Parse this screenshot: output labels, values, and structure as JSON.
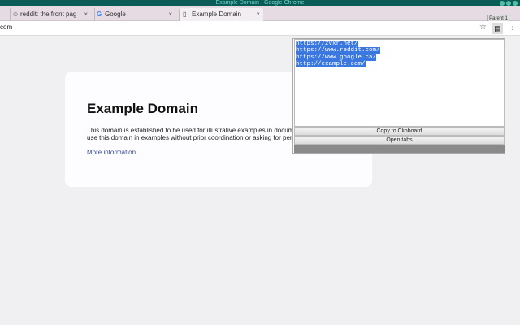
{
  "window": {
    "title": "Example Domain - Google Chrome"
  },
  "tabs": [
    {
      "label": "reddit: the front pag",
      "icon": "reddit-icon"
    },
    {
      "label": "Google",
      "icon": "google-icon"
    },
    {
      "label": "Example Domain",
      "icon": "page-icon",
      "active": true
    }
  ],
  "profile_button": "Parent 1",
  "address_bar": {
    "value": "com"
  },
  "page": {
    "heading": "Example Domain",
    "paragraph_line1": "This domain is established to be used for illustrative examples in documents. You may",
    "paragraph_line2": "use this domain in examples without prior coordination or asking for permission.",
    "link": "More information..."
  },
  "popup": {
    "urls": [
      "https://zvxr.net/",
      "https://www.reddit.com/",
      "https://www.google.ca/",
      "http://example.com/"
    ],
    "copy_button": "Copy to Clipboard",
    "open_button": "Open tabs"
  }
}
